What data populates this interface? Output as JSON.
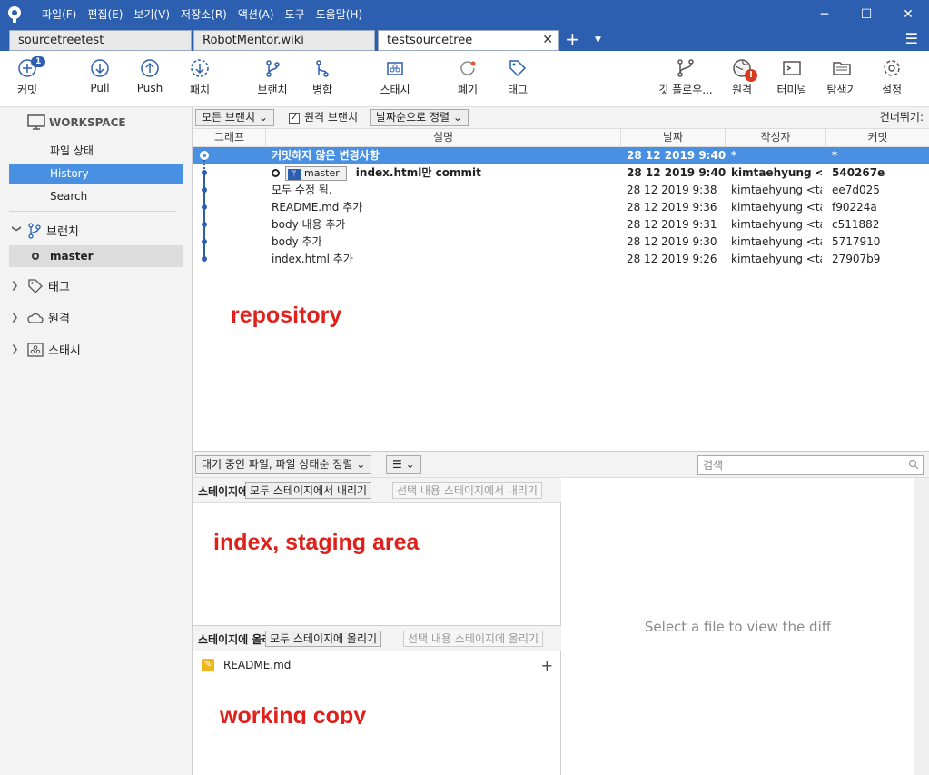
{
  "menu": [
    "파일(F)",
    "편집(E)",
    "보기(V)",
    "저장소(R)",
    "액션(A)",
    "도구",
    "도움말(H)"
  ],
  "window_controls": {
    "minimize": "─",
    "maximize": "☐",
    "close": "✕"
  },
  "tabs": [
    {
      "label": "sourcetreetest"
    },
    {
      "label": "RobotMentor.wiki"
    },
    {
      "label": "testsourcetree",
      "close": "✕"
    }
  ],
  "tab_add": "+",
  "tab_menu": "▼",
  "tab_list": "☰",
  "toolbar": {
    "commit": "커밋",
    "commit_badge": "1",
    "pull": "Pull",
    "push": "Push",
    "patch": "패치",
    "branch": "브랜치",
    "merge": "병합",
    "stash": "스태시",
    "discard": "폐기",
    "tag": "태그",
    "gitflow": "깃 플로우...",
    "remote": "원격",
    "remote_alert": "!",
    "terminal": "터미널",
    "explorer": "탐색기",
    "settings": "설정"
  },
  "sidebar": {
    "workspace": "WORKSPACE",
    "items": [
      {
        "label": "파일 상태"
      },
      {
        "label": "History"
      },
      {
        "label": "Search"
      }
    ],
    "branches_label": "브랜치",
    "current_branch": "master",
    "tags_label": "태그",
    "remotes_label": "원격",
    "stashes_label": "스태시",
    "expand": "❯",
    "collapse": "❯"
  },
  "filter": {
    "branches": "모든 브랜치 ⌄",
    "remote_check": "원격 브랜치",
    "sort": "날짜순으로 정렬 ⌄",
    "skip": "건너뛰기:",
    "check_mark": "✓"
  },
  "columns": [
    "그래프",
    "설명",
    "날짜",
    "작성자",
    "커밋"
  ],
  "commits": [
    {
      "desc": "커밋하지 않은 변경사항",
      "date": "28 12 2019 9:40",
      "author": "*",
      "hash": "*"
    },
    {
      "branch": "master",
      "desc": "index.html만 commit",
      "date": "28 12 2019 9:40",
      "author": "kimtaehyung <ta",
      "hash": "540267e"
    },
    {
      "desc": "모두 수정 됨.",
      "date": "28 12 2019 9:38",
      "author": "kimtaehyung <tae",
      "hash": "ee7d025"
    },
    {
      "desc": "README.md 추가",
      "date": "28 12 2019 9:36",
      "author": "kimtaehyung <tae",
      "hash": "f90224a"
    },
    {
      "desc": "body 내용 추가",
      "date": "28 12 2019 9:31",
      "author": "kimtaehyung <tae",
      "hash": "c511882"
    },
    {
      "desc": "body 추가",
      "date": "28 12 2019 9:30",
      "author": "kimtaehyung <tae",
      "hash": "5717910"
    },
    {
      "desc": "index.html 추가",
      "date": "28 12 2019 9:26",
      "author": "kimtaehyung <tae",
      "hash": "27907b9"
    }
  ],
  "branch_icon": "ᛘ",
  "annotations": {
    "repository": "repository",
    "staging": "index, staging area",
    "working": "working copy"
  },
  "bottom": {
    "sort": "대기 중인 파일, 파일 상태순 정렬 ⌄",
    "view": "☰ ⌄",
    "search_placeholder": "검색"
  },
  "staged": {
    "label": "스테이지에 올린 파일",
    "unstage_all": "모두 스테이지에서 내리기",
    "unstage_selected": "선택 내용 스테이지에서 내리기"
  },
  "unstaged": {
    "label": "스테이지에 올리지 않은 파일",
    "stage_all": "모두 스테이지에 올리기",
    "stage_selected": "선택 내용 스테이지에 올리기",
    "files": [
      {
        "name": "README.md",
        "status": "✎"
      }
    ],
    "add": "+"
  },
  "diff_placeholder": "Select a file to view the diff"
}
